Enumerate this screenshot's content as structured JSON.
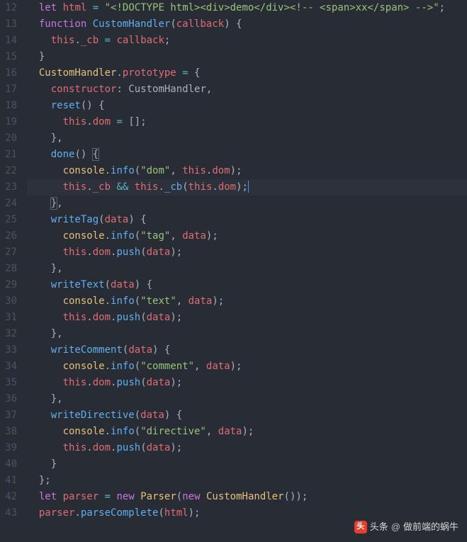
{
  "lines": [
    {
      "n": 12,
      "hl": false,
      "tokens": [
        {
          "c": "pl",
          "t": "  "
        },
        {
          "c": "kw",
          "t": "let"
        },
        {
          "c": "pl",
          "t": " "
        },
        {
          "c": "pr",
          "t": "html"
        },
        {
          "c": "pl",
          "t": " "
        },
        {
          "c": "op",
          "t": "="
        },
        {
          "c": "pl",
          "t": " "
        },
        {
          "c": "st",
          "t": "\"<!DOCTYPE html><div>demo</div><!-- <span>xx</span> -->\""
        },
        {
          "c": "pu",
          "t": ";"
        }
      ]
    },
    {
      "n": 13,
      "hl": false,
      "tokens": [
        {
          "c": "pl",
          "t": "  "
        },
        {
          "c": "kw",
          "t": "function"
        },
        {
          "c": "pl",
          "t": " "
        },
        {
          "c": "fn",
          "t": "CustomHandler"
        },
        {
          "c": "pu",
          "t": "("
        },
        {
          "c": "pr",
          "t": "callback"
        },
        {
          "c": "pu",
          "t": ")"
        },
        {
          "c": "pl",
          "t": " "
        },
        {
          "c": "pu",
          "t": "{"
        }
      ]
    },
    {
      "n": 14,
      "hl": false,
      "tokens": [
        {
          "c": "pl",
          "t": "    "
        },
        {
          "c": "va",
          "t": "this"
        },
        {
          "c": "pu",
          "t": "."
        },
        {
          "c": "pr",
          "t": "_cb"
        },
        {
          "c": "pl",
          "t": " "
        },
        {
          "c": "op",
          "t": "="
        },
        {
          "c": "pl",
          "t": " "
        },
        {
          "c": "pr",
          "t": "callback"
        },
        {
          "c": "pu",
          "t": ";"
        }
      ]
    },
    {
      "n": 15,
      "hl": false,
      "tokens": [
        {
          "c": "pl",
          "t": "  "
        },
        {
          "c": "pu",
          "t": "}"
        }
      ]
    },
    {
      "n": 16,
      "hl": false,
      "tokens": [
        {
          "c": "pl",
          "t": "  "
        },
        {
          "c": "cl",
          "t": "CustomHandler"
        },
        {
          "c": "pu",
          "t": "."
        },
        {
          "c": "pr",
          "t": "prototype"
        },
        {
          "c": "pl",
          "t": " "
        },
        {
          "c": "op",
          "t": "="
        },
        {
          "c": "pl",
          "t": " "
        },
        {
          "c": "pu",
          "t": "{"
        }
      ]
    },
    {
      "n": 17,
      "hl": false,
      "tokens": [
        {
          "c": "pl",
          "t": "    "
        },
        {
          "c": "pr",
          "t": "constructor"
        },
        {
          "c": "pu",
          "t": ": "
        },
        {
          "c": "pl",
          "t": "CustomHandler"
        },
        {
          "c": "pu",
          "t": ","
        }
      ]
    },
    {
      "n": 18,
      "hl": false,
      "tokens": [
        {
          "c": "pl",
          "t": "    "
        },
        {
          "c": "fn",
          "t": "reset"
        },
        {
          "c": "pu",
          "t": "()"
        },
        {
          "c": "pl",
          "t": " "
        },
        {
          "c": "pu",
          "t": "{"
        }
      ]
    },
    {
      "n": 19,
      "hl": false,
      "tokens": [
        {
          "c": "pl",
          "t": "      "
        },
        {
          "c": "va",
          "t": "this"
        },
        {
          "c": "pu",
          "t": "."
        },
        {
          "c": "pr",
          "t": "dom"
        },
        {
          "c": "pl",
          "t": " "
        },
        {
          "c": "op",
          "t": "="
        },
        {
          "c": "pl",
          "t": " "
        },
        {
          "c": "pu",
          "t": "[];"
        }
      ]
    },
    {
      "n": 20,
      "hl": false,
      "tokens": [
        {
          "c": "pl",
          "t": "    "
        },
        {
          "c": "pu",
          "t": "},"
        }
      ]
    },
    {
      "n": 21,
      "hl": false,
      "tokens": [
        {
          "c": "pl",
          "t": "    "
        },
        {
          "c": "fn",
          "t": "done"
        },
        {
          "c": "pu",
          "t": "()"
        },
        {
          "c": "pl",
          "t": " "
        },
        {
          "c": "pu",
          "t": "{",
          "bm": true
        }
      ]
    },
    {
      "n": 22,
      "hl": false,
      "tokens": [
        {
          "c": "pl",
          "t": "      "
        },
        {
          "c": "cl",
          "t": "console"
        },
        {
          "c": "pu",
          "t": "."
        },
        {
          "c": "fn",
          "t": "info"
        },
        {
          "c": "pu",
          "t": "("
        },
        {
          "c": "st",
          "t": "\"dom\""
        },
        {
          "c": "pu",
          "t": ", "
        },
        {
          "c": "va",
          "t": "this"
        },
        {
          "c": "pu",
          "t": "."
        },
        {
          "c": "pr",
          "t": "dom"
        },
        {
          "c": "pu",
          "t": ");"
        }
      ]
    },
    {
      "n": 23,
      "hl": true,
      "cursor": true,
      "tokens": [
        {
          "c": "pl",
          "t": "      "
        },
        {
          "c": "va",
          "t": "this"
        },
        {
          "c": "pu",
          "t": "."
        },
        {
          "c": "pr",
          "t": "_cb"
        },
        {
          "c": "pl",
          "t": " "
        },
        {
          "c": "op",
          "t": "&&"
        },
        {
          "c": "pl",
          "t": " "
        },
        {
          "c": "va",
          "t": "this"
        },
        {
          "c": "pu",
          "t": "."
        },
        {
          "c": "fn",
          "t": "_cb"
        },
        {
          "c": "pu",
          "t": "("
        },
        {
          "c": "va",
          "t": "this"
        },
        {
          "c": "pu",
          "t": "."
        },
        {
          "c": "pr",
          "t": "dom"
        },
        {
          "c": "pu",
          "t": ");"
        }
      ]
    },
    {
      "n": 24,
      "hl": false,
      "tokens": [
        {
          "c": "pl",
          "t": "    "
        },
        {
          "c": "pu",
          "t": "}",
          "bm": true
        },
        {
          "c": "pu",
          "t": ","
        }
      ]
    },
    {
      "n": 25,
      "hl": false,
      "tokens": [
        {
          "c": "pl",
          "t": "    "
        },
        {
          "c": "fn",
          "t": "writeTag"
        },
        {
          "c": "pu",
          "t": "("
        },
        {
          "c": "pr",
          "t": "data"
        },
        {
          "c": "pu",
          "t": ")"
        },
        {
          "c": "pl",
          "t": " "
        },
        {
          "c": "pu",
          "t": "{"
        }
      ]
    },
    {
      "n": 26,
      "hl": false,
      "tokens": [
        {
          "c": "pl",
          "t": "      "
        },
        {
          "c": "cl",
          "t": "console"
        },
        {
          "c": "pu",
          "t": "."
        },
        {
          "c": "fn",
          "t": "info"
        },
        {
          "c": "pu",
          "t": "("
        },
        {
          "c": "st",
          "t": "\"tag\""
        },
        {
          "c": "pu",
          "t": ", "
        },
        {
          "c": "pr",
          "t": "data"
        },
        {
          "c": "pu",
          "t": ");"
        }
      ]
    },
    {
      "n": 27,
      "hl": false,
      "tokens": [
        {
          "c": "pl",
          "t": "      "
        },
        {
          "c": "va",
          "t": "this"
        },
        {
          "c": "pu",
          "t": "."
        },
        {
          "c": "pr",
          "t": "dom"
        },
        {
          "c": "pu",
          "t": "."
        },
        {
          "c": "fn",
          "t": "push"
        },
        {
          "c": "pu",
          "t": "("
        },
        {
          "c": "pr",
          "t": "data"
        },
        {
          "c": "pu",
          "t": ");"
        }
      ]
    },
    {
      "n": 28,
      "hl": false,
      "tokens": [
        {
          "c": "pl",
          "t": "    "
        },
        {
          "c": "pu",
          "t": "},"
        }
      ]
    },
    {
      "n": 29,
      "hl": false,
      "tokens": [
        {
          "c": "pl",
          "t": "    "
        },
        {
          "c": "fn",
          "t": "writeText"
        },
        {
          "c": "pu",
          "t": "("
        },
        {
          "c": "pr",
          "t": "data"
        },
        {
          "c": "pu",
          "t": ")"
        },
        {
          "c": "pl",
          "t": " "
        },
        {
          "c": "pu",
          "t": "{"
        }
      ]
    },
    {
      "n": 30,
      "hl": false,
      "tokens": [
        {
          "c": "pl",
          "t": "      "
        },
        {
          "c": "cl",
          "t": "console"
        },
        {
          "c": "pu",
          "t": "."
        },
        {
          "c": "fn",
          "t": "info"
        },
        {
          "c": "pu",
          "t": "("
        },
        {
          "c": "st",
          "t": "\"text\""
        },
        {
          "c": "pu",
          "t": ", "
        },
        {
          "c": "pr",
          "t": "data"
        },
        {
          "c": "pu",
          "t": ");"
        }
      ]
    },
    {
      "n": 31,
      "hl": false,
      "tokens": [
        {
          "c": "pl",
          "t": "      "
        },
        {
          "c": "va",
          "t": "this"
        },
        {
          "c": "pu",
          "t": "."
        },
        {
          "c": "pr",
          "t": "dom"
        },
        {
          "c": "pu",
          "t": "."
        },
        {
          "c": "fn",
          "t": "push"
        },
        {
          "c": "pu",
          "t": "("
        },
        {
          "c": "pr",
          "t": "data"
        },
        {
          "c": "pu",
          "t": ");"
        }
      ]
    },
    {
      "n": 32,
      "hl": false,
      "tokens": [
        {
          "c": "pl",
          "t": "    "
        },
        {
          "c": "pu",
          "t": "},"
        }
      ]
    },
    {
      "n": 33,
      "hl": false,
      "tokens": [
        {
          "c": "pl",
          "t": "    "
        },
        {
          "c": "fn",
          "t": "writeComment"
        },
        {
          "c": "pu",
          "t": "("
        },
        {
          "c": "pr",
          "t": "data"
        },
        {
          "c": "pu",
          "t": ")"
        },
        {
          "c": "pl",
          "t": " "
        },
        {
          "c": "pu",
          "t": "{"
        }
      ]
    },
    {
      "n": 34,
      "hl": false,
      "tokens": [
        {
          "c": "pl",
          "t": "      "
        },
        {
          "c": "cl",
          "t": "console"
        },
        {
          "c": "pu",
          "t": "."
        },
        {
          "c": "fn",
          "t": "info"
        },
        {
          "c": "pu",
          "t": "("
        },
        {
          "c": "st",
          "t": "\"comment\""
        },
        {
          "c": "pu",
          "t": ", "
        },
        {
          "c": "pr",
          "t": "data"
        },
        {
          "c": "pu",
          "t": ");"
        }
      ]
    },
    {
      "n": 35,
      "hl": false,
      "tokens": [
        {
          "c": "pl",
          "t": "      "
        },
        {
          "c": "va",
          "t": "this"
        },
        {
          "c": "pu",
          "t": "."
        },
        {
          "c": "pr",
          "t": "dom"
        },
        {
          "c": "pu",
          "t": "."
        },
        {
          "c": "fn",
          "t": "push"
        },
        {
          "c": "pu",
          "t": "("
        },
        {
          "c": "pr",
          "t": "data"
        },
        {
          "c": "pu",
          "t": ");"
        }
      ]
    },
    {
      "n": 36,
      "hl": false,
      "tokens": [
        {
          "c": "pl",
          "t": "    "
        },
        {
          "c": "pu",
          "t": "},"
        }
      ]
    },
    {
      "n": 37,
      "hl": false,
      "tokens": [
        {
          "c": "pl",
          "t": "    "
        },
        {
          "c": "fn",
          "t": "writeDirective"
        },
        {
          "c": "pu",
          "t": "("
        },
        {
          "c": "pr",
          "t": "data"
        },
        {
          "c": "pu",
          "t": ")"
        },
        {
          "c": "pl",
          "t": " "
        },
        {
          "c": "pu",
          "t": "{"
        }
      ]
    },
    {
      "n": 38,
      "hl": false,
      "tokens": [
        {
          "c": "pl",
          "t": "      "
        },
        {
          "c": "cl",
          "t": "console"
        },
        {
          "c": "pu",
          "t": "."
        },
        {
          "c": "fn",
          "t": "info"
        },
        {
          "c": "pu",
          "t": "("
        },
        {
          "c": "st",
          "t": "\"directive\""
        },
        {
          "c": "pu",
          "t": ", "
        },
        {
          "c": "pr",
          "t": "data"
        },
        {
          "c": "pu",
          "t": ");"
        }
      ]
    },
    {
      "n": 39,
      "hl": false,
      "tokens": [
        {
          "c": "pl",
          "t": "      "
        },
        {
          "c": "va",
          "t": "this"
        },
        {
          "c": "pu",
          "t": "."
        },
        {
          "c": "pr",
          "t": "dom"
        },
        {
          "c": "pu",
          "t": "."
        },
        {
          "c": "fn",
          "t": "push"
        },
        {
          "c": "pu",
          "t": "("
        },
        {
          "c": "pr",
          "t": "data"
        },
        {
          "c": "pu",
          "t": ");"
        }
      ]
    },
    {
      "n": 40,
      "hl": false,
      "tokens": [
        {
          "c": "pl",
          "t": "    "
        },
        {
          "c": "pu",
          "t": "}"
        }
      ]
    },
    {
      "n": 41,
      "hl": false,
      "tokens": [
        {
          "c": "pl",
          "t": "  "
        },
        {
          "c": "pu",
          "t": "};"
        }
      ]
    },
    {
      "n": 42,
      "hl": false,
      "tokens": [
        {
          "c": "pl",
          "t": "  "
        },
        {
          "c": "kw",
          "t": "let"
        },
        {
          "c": "pl",
          "t": " "
        },
        {
          "c": "pr",
          "t": "parser"
        },
        {
          "c": "pl",
          "t": " "
        },
        {
          "c": "op",
          "t": "="
        },
        {
          "c": "pl",
          "t": " "
        },
        {
          "c": "kw",
          "t": "new"
        },
        {
          "c": "pl",
          "t": " "
        },
        {
          "c": "cl",
          "t": "Parser"
        },
        {
          "c": "pu",
          "t": "("
        },
        {
          "c": "kw",
          "t": "new"
        },
        {
          "c": "pl",
          "t": " "
        },
        {
          "c": "cl",
          "t": "CustomHandler"
        },
        {
          "c": "pu",
          "t": "());"
        }
      ]
    },
    {
      "n": 43,
      "hl": false,
      "tokens": [
        {
          "c": "pl",
          "t": "  "
        },
        {
          "c": "pr",
          "t": "parser"
        },
        {
          "c": "pu",
          "t": "."
        },
        {
          "c": "fn",
          "t": "parseComplete"
        },
        {
          "c": "pu",
          "t": "("
        },
        {
          "c": "pr",
          "t": "html"
        },
        {
          "c": "pu",
          "t": ");"
        }
      ]
    }
  ],
  "watermark": {
    "prefix": "头条",
    "at": "@",
    "author": "做前端的蜗牛"
  }
}
